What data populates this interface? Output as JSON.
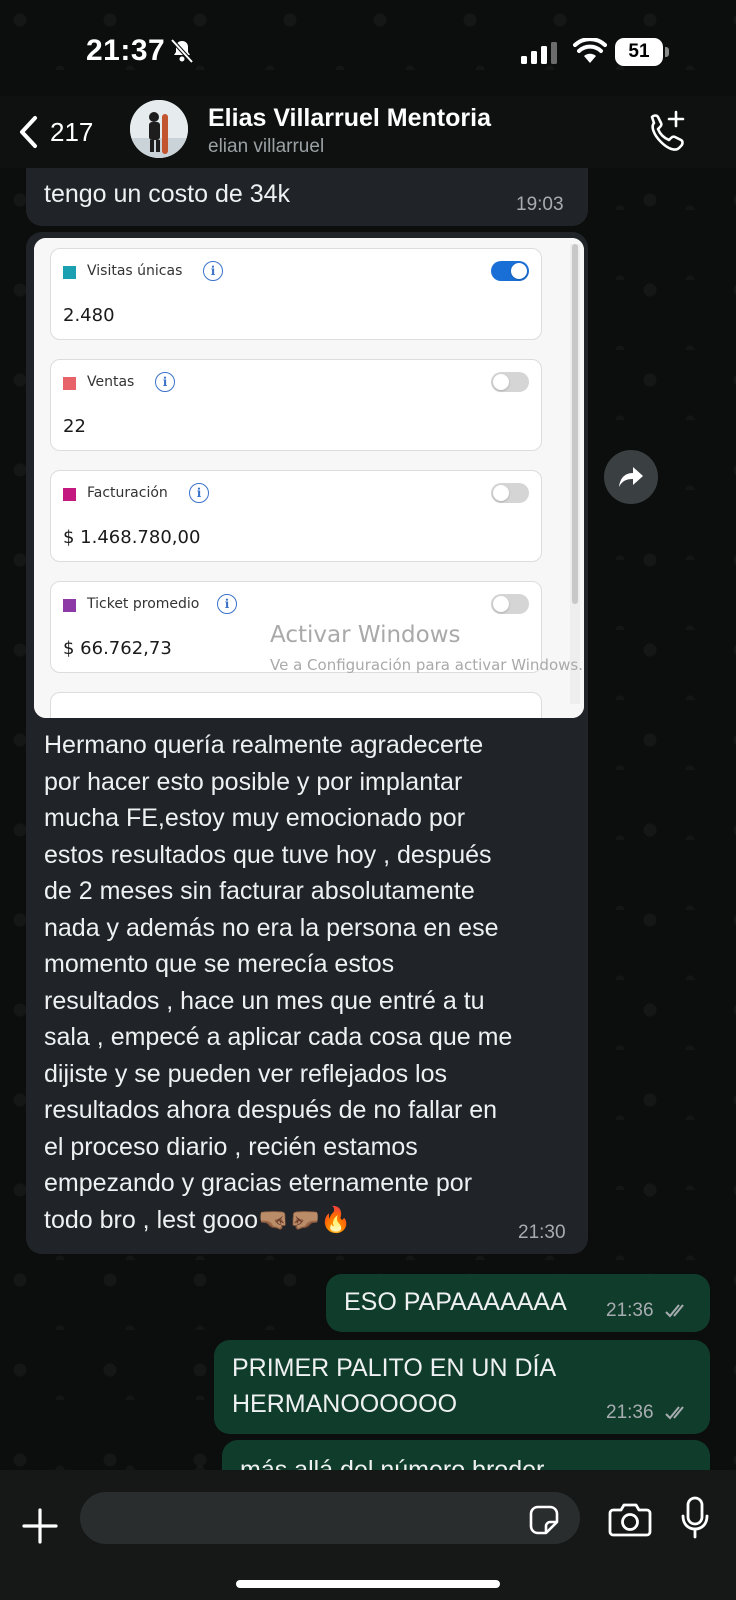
{
  "status_bar": {
    "time": "21:37",
    "battery": "51"
  },
  "header": {
    "back_count": "217",
    "contact_name": "Elias Villarruel Mentoria",
    "contact_subtitle": "elian villarruel"
  },
  "messages": {
    "m1": {
      "text": "tengo un costo de 34k",
      "time": "19:03"
    },
    "image": {
      "cards": [
        {
          "label": "Visitas únicas",
          "value": "2.480",
          "color": "#1aa0b0",
          "toggle": "on"
        },
        {
          "label": "Ventas",
          "value": "22",
          "color": "#e8626a",
          "toggle": "off"
        },
        {
          "label": "Facturación",
          "value": "$ 1.468.780,00",
          "color": "#c4197f",
          "toggle": "off"
        },
        {
          "label": "Ticket promedio",
          "value": "$ 66.762,73",
          "color": "#8e3aa6",
          "toggle": "off"
        }
      ],
      "watermark_title": "Activar Windows",
      "watermark_subtitle": "Ve a Configuración para activar Windows."
    },
    "m2": {
      "lines": [
        "Hermano quería realmente agradecerte",
        "por hacer esto posible y por implantar",
        "mucha FE,estoy muy emocionado por",
        "estos resultados que tuve hoy , después",
        "de 2 meses sin facturar absolutamente",
        "nada y además no era la persona en ese",
        "momento que se merecía estos",
        "resultados , hace un mes que entré a tu",
        "sala , empecé a aplicar cada cosa que me",
        "dijiste y se pueden ver reflejados los",
        "resultados ahora después de no fallar en",
        "el proceso diario , recién estamos",
        "empezando y gracias eternamente por",
        "todo bro , lest gooo🤜🏽🤛🏽🔥"
      ],
      "time": "21:30"
    },
    "m3": {
      "text": "ESO PAPAAAAAAA",
      "time": "21:36"
    },
    "m4": {
      "line1": "PRIMER PALITO EN UN DÍA",
      "line2": "HERMANOOOOOO",
      "time": "21:36"
    },
    "m5": {
      "text": "más allá del número broder"
    }
  },
  "composer": {
    "placeholder": ""
  },
  "colors": {
    "incoming_bubble": "#202428",
    "outgoing_bubble": "#103d2b",
    "read_ticks": "#a7acb0"
  }
}
